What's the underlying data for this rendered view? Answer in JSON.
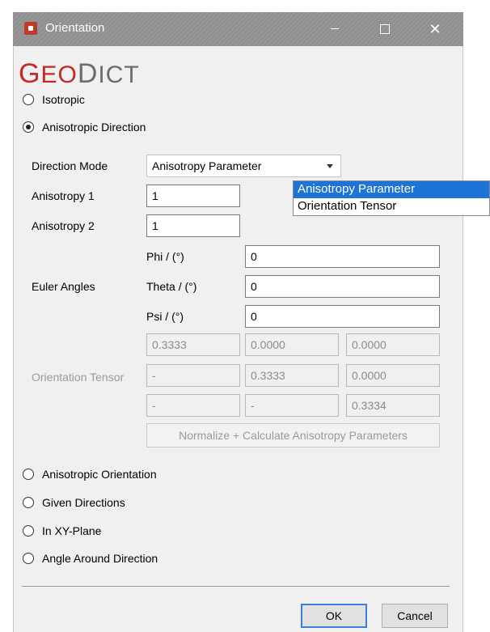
{
  "window": {
    "title": "Orientation"
  },
  "logo": {
    "part1_big": "G",
    "part1_rest": "EO",
    "part2_big": "D",
    "part2_rest": "ICT"
  },
  "options": {
    "isotropic": "Isotropic",
    "anisotropic_direction": "Anisotropic Direction",
    "anisotropic_orientation": "Anisotropic Orientation",
    "given_directions": "Given Directions",
    "in_xy_plane": "In XY-Plane",
    "angle_around_direction": "Angle Around Direction",
    "selected": "anisotropic_direction"
  },
  "direction_mode": {
    "label": "Direction Mode",
    "value": "Anisotropy Parameter",
    "options": [
      "Anisotropy Parameter",
      "Orientation Tensor"
    ]
  },
  "anisotropy": {
    "a1_label": "Anisotropy 1",
    "a1_value": "1",
    "a2_label": "Anisotropy 2",
    "a2_value": "1"
  },
  "euler": {
    "label": "Euler Angles",
    "phi_label": "Phi / (°)",
    "phi_value": "0",
    "theta_label": "Theta / (°)",
    "theta_value": "0",
    "psi_label": "Psi / (°)",
    "psi_value": "0"
  },
  "tensor": {
    "label": "Orientation Tensor",
    "rows": [
      [
        "0.3333",
        "0.0000",
        "0.0000"
      ],
      [
        "-",
        "0.3333",
        "0.0000"
      ],
      [
        "-",
        "-",
        "0.3334"
      ]
    ],
    "normalize_label": "Normalize + Calculate Anisotropy Parameters"
  },
  "buttons": {
    "ok": "OK",
    "cancel": "Cancel"
  }
}
